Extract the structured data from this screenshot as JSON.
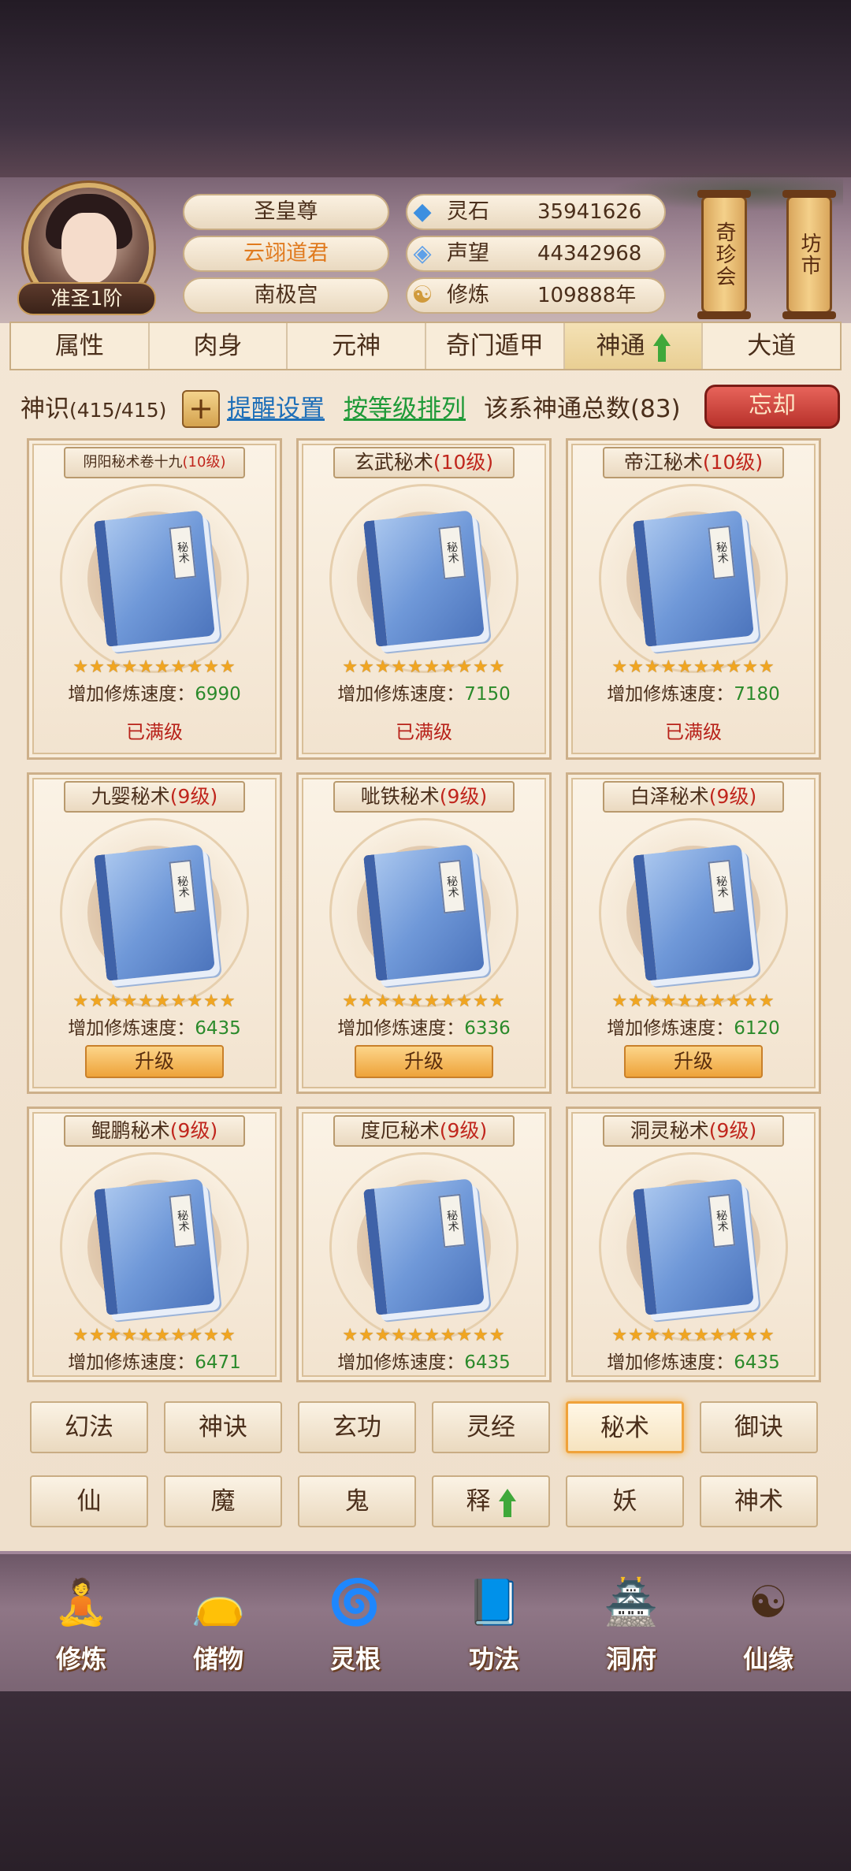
{
  "player": {
    "rank": "准圣1阶",
    "titles": [
      "圣皇尊",
      "云翊道君",
      "南极宫"
    ],
    "title_colors": [
      "#4a2e1a",
      "#e07a1e",
      "#4a2e1a"
    ]
  },
  "resources": [
    {
      "icon": "spirit-stone-icon",
      "glyph": "◆",
      "color": "#3d8fe0",
      "label": "灵石",
      "value": "35941626"
    },
    {
      "icon": "prestige-icon",
      "glyph": "◈",
      "color": "#5fa0e8",
      "label": "声望",
      "value": "44342968"
    },
    {
      "icon": "cultivation-icon",
      "glyph": "☯",
      "color": "#d09a3c",
      "label": "修炼",
      "value": "109888年"
    }
  ],
  "side_buttons": [
    "奇珍会",
    "坊市"
  ],
  "tabs": [
    "属性",
    "肉身",
    "元神",
    "奇门遁甲",
    "神通",
    "大道"
  ],
  "active_tab": 4,
  "info": {
    "label": "神识",
    "count": "(415/415)",
    "plus": "+",
    "remind": "提醒设置",
    "sort": "按等级排列",
    "total": "该系神通总数(83)",
    "forget": "忘却"
  },
  "cards": [
    {
      "name": "阴阳秘术卷十九",
      "level": "(10级)",
      "stars": "★★★★★★★★★★",
      "speed_label": "增加修炼速度：",
      "speed": "6990",
      "status": "已满级"
    },
    {
      "name": "玄武秘术",
      "level": "(10级)",
      "stars": "★★★★★★★★★★",
      "speed_label": "增加修炼速度：",
      "speed": "7150",
      "status": "已满级"
    },
    {
      "name": "帝江秘术",
      "level": "(10级)",
      "stars": "★★★★★★★★★★",
      "speed_label": "增加修炼速度：",
      "speed": "7180",
      "status": "已满级"
    },
    {
      "name": "九婴秘术",
      "level": "(9级)",
      "stars": "★★★★★★★★★★",
      "speed_label": "增加修炼速度：",
      "speed": "6435",
      "button": "升级"
    },
    {
      "name": "呲铁秘术",
      "level": "(9级)",
      "stars": "★★★★★★★★★★",
      "speed_label": "增加修炼速度：",
      "speed": "6336",
      "button": "升级"
    },
    {
      "name": "白泽秘术",
      "level": "(9级)",
      "stars": "★★★★★★★★★★",
      "speed_label": "增加修炼速度：",
      "speed": "6120",
      "button": "升级"
    },
    {
      "name": "鲲鹏秘术",
      "level": "(9级)",
      "stars": "★★★★★★★★★★",
      "speed_label": "增加修炼速度：",
      "speed": "6471"
    },
    {
      "name": "度厄秘术",
      "level": "(9级)",
      "stars": "★★★★★★★★★★",
      "speed_label": "增加修炼速度：",
      "speed": "6435"
    },
    {
      "name": "洞灵秘术",
      "level": "(9级)",
      "stars": "★★★★★★★★★★",
      "speed_label": "增加修炼速度：",
      "speed": "6435"
    }
  ],
  "book_label": "秘术",
  "categories_row1": [
    "幻法",
    "神诀",
    "玄功",
    "灵经",
    "秘术",
    "御诀"
  ],
  "categories_row2": [
    "仙",
    "魔",
    "鬼",
    "释",
    "妖",
    "神术"
  ],
  "active_category": "秘术",
  "bottom_nav": [
    {
      "label": "修炼",
      "icon": "cultivate-icon",
      "glyph": "🧘"
    },
    {
      "label": "储物",
      "icon": "storage-bag-icon",
      "glyph": "👝"
    },
    {
      "label": "灵根",
      "icon": "spirit-root-icon",
      "glyph": "🌀"
    },
    {
      "label": "功法",
      "icon": "scripture-book-icon",
      "glyph": "📘"
    },
    {
      "label": "洞府",
      "icon": "cave-house-icon",
      "glyph": "🏯"
    },
    {
      "label": "仙缘",
      "icon": "immortal-fate-icon",
      "glyph": "☯"
    }
  ]
}
